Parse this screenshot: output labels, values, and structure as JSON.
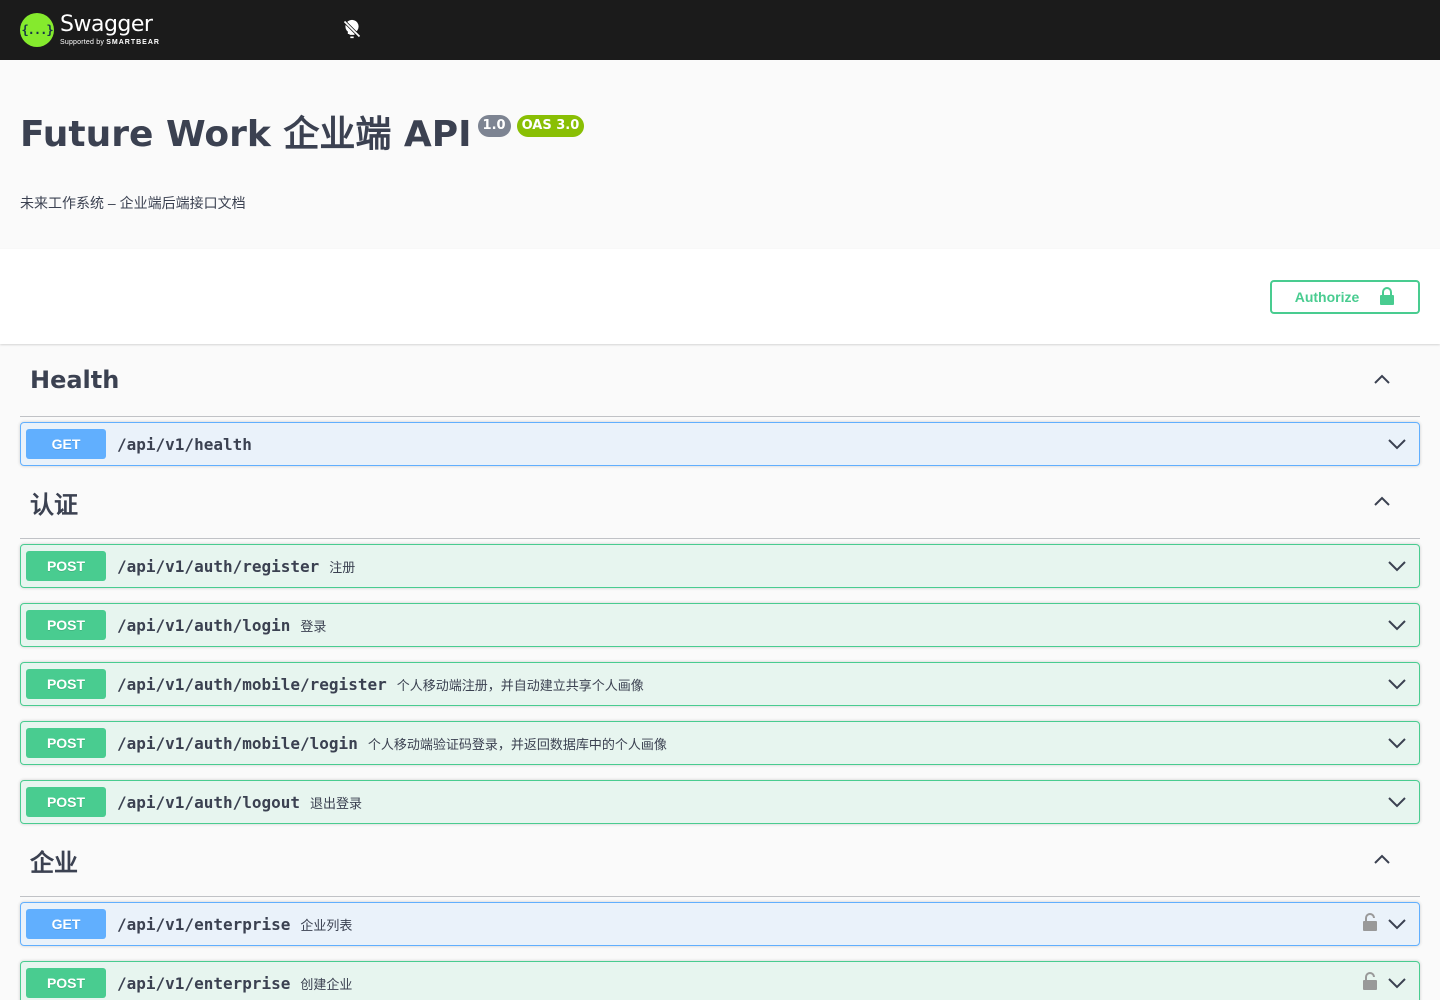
{
  "topbar": {
    "logo_mark": "{...}",
    "logo_title": "Swagger",
    "logo_sub_prefix": "Supported by",
    "logo_sub_brand": "SMARTBEAR",
    "theme_icon": "lightbulb-off-icon"
  },
  "info": {
    "title": "Future Work 企业端 API",
    "version": "1.0",
    "oas": "OAS 3.0",
    "description": "未来工作系统 – 企业端后端接口文档"
  },
  "authorize": {
    "label": "Authorize",
    "icon": "lock-icon"
  },
  "colors": {
    "get": "#61affe",
    "post": "#49cc90",
    "topbar": "#1b1b1b",
    "logo": "#85ea2d"
  },
  "tags": [
    {
      "name": "Health",
      "ops": [
        {
          "method": "GET",
          "path": "/api/v1/health",
          "summary": "",
          "locked": false
        }
      ]
    },
    {
      "name": "认证",
      "ops": [
        {
          "method": "POST",
          "path": "/api/v1/auth/register",
          "summary": "注册",
          "locked": false
        },
        {
          "method": "POST",
          "path": "/api/v1/auth/login",
          "summary": "登录",
          "locked": false
        },
        {
          "method": "POST",
          "path": "/api/v1/auth/mobile/register",
          "summary": "个人移动端注册，并自动建立共享个人画像",
          "locked": false
        },
        {
          "method": "POST",
          "path": "/api/v1/auth/mobile/login",
          "summary": "个人移动端验证码登录，并返回数据库中的个人画像",
          "locked": false
        },
        {
          "method": "POST",
          "path": "/api/v1/auth/logout",
          "summary": "退出登录",
          "locked": false
        }
      ]
    },
    {
      "name": "企业",
      "ops": [
        {
          "method": "GET",
          "path": "/api/v1/enterprise",
          "summary": "企业列表",
          "locked": true
        },
        {
          "method": "POST",
          "path": "/api/v1/enterprise",
          "summary": "创建企业",
          "locked": true
        }
      ]
    }
  ]
}
